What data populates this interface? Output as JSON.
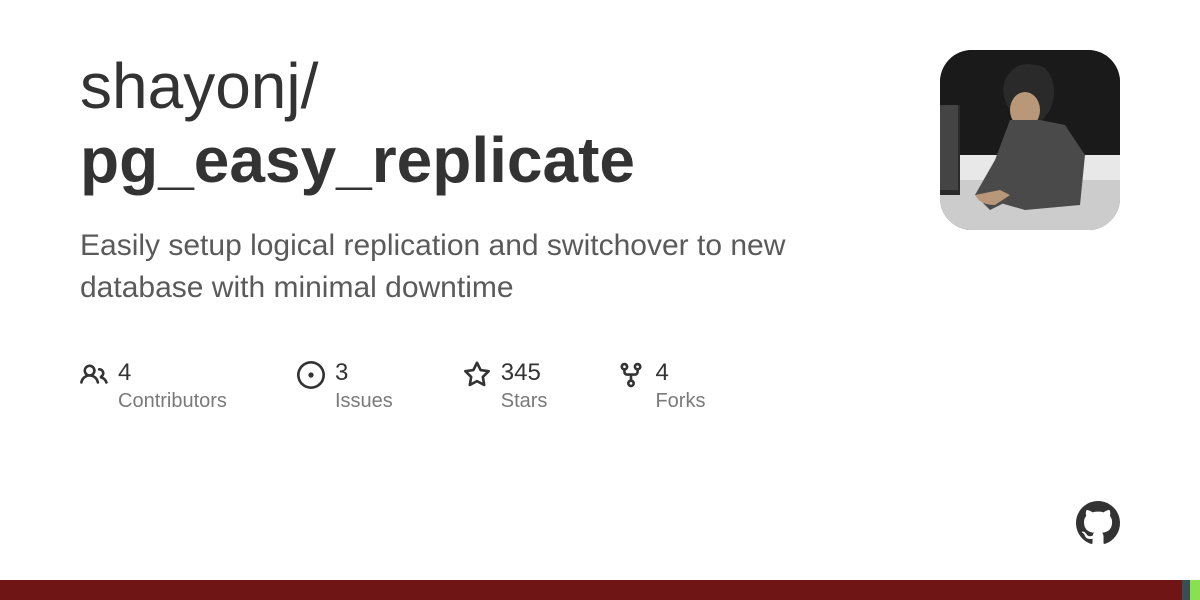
{
  "repo": {
    "owner": "shayonj",
    "name": "pg_easy_replicate",
    "description": "Easily setup logical replication and switchover to new database with minimal downtime"
  },
  "stats": {
    "contributors": {
      "count": "4",
      "label": "Contributors"
    },
    "issues": {
      "count": "3",
      "label": "Issues"
    },
    "stars": {
      "count": "345",
      "label": "Stars"
    },
    "forks": {
      "count": "4",
      "label": "Forks"
    }
  },
  "language_bar": [
    {
      "color": "#701516",
      "width": "98.5%"
    },
    {
      "color": "#384d54",
      "width": "0.7%"
    },
    {
      "color": "#89e051",
      "width": "0.8%"
    }
  ]
}
